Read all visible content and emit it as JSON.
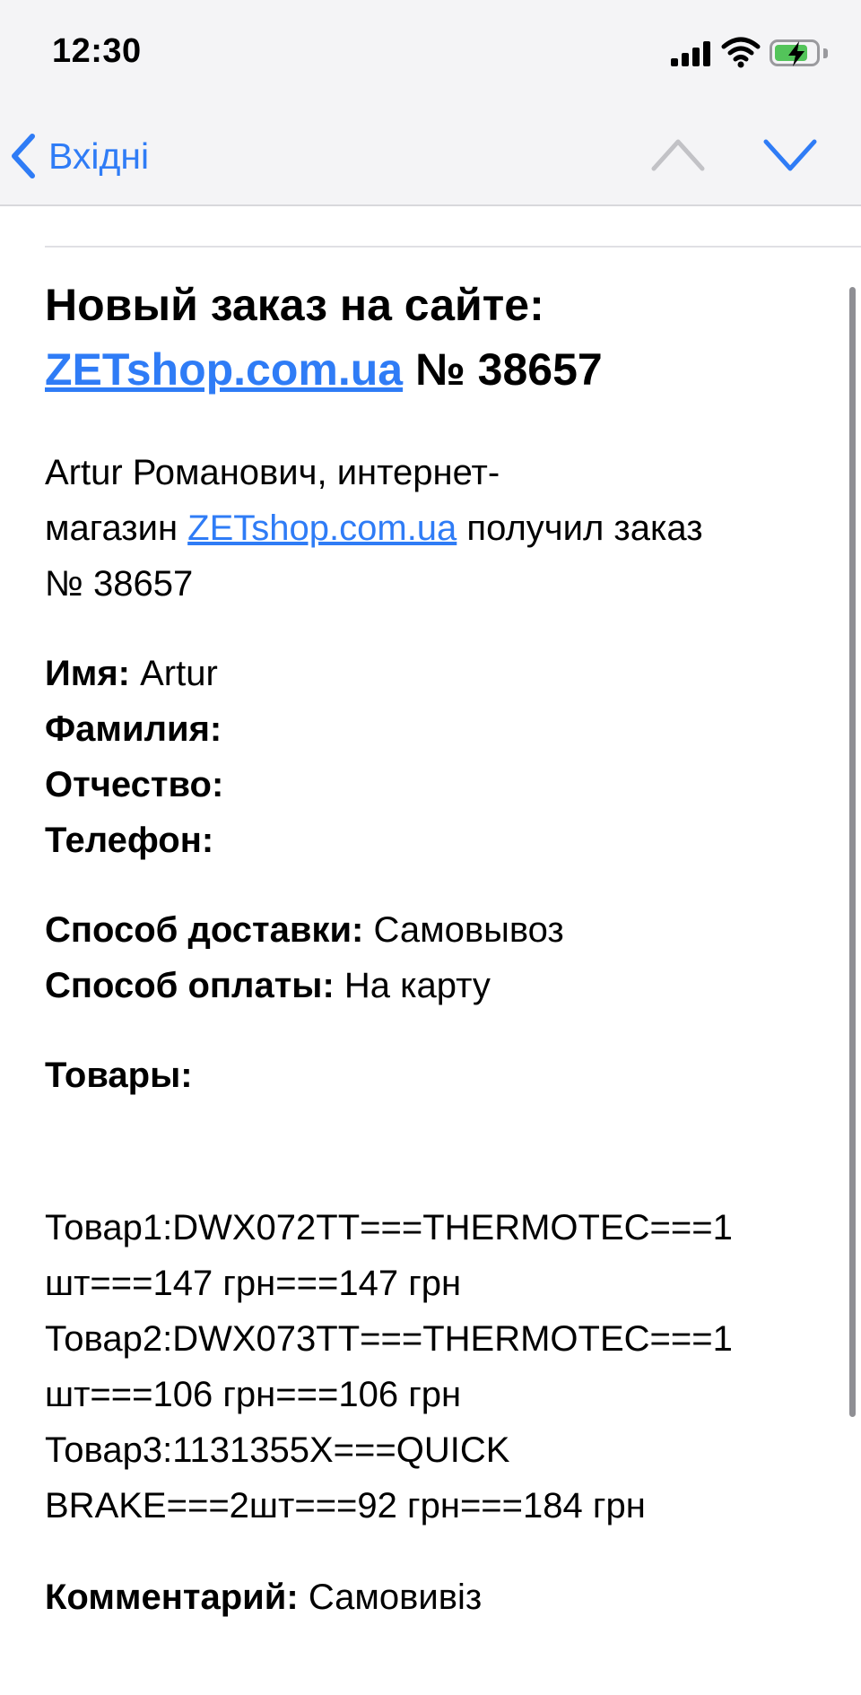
{
  "status_bar": {
    "time": "12:30",
    "icons": [
      "cellular-signal-icon",
      "wifi-icon",
      "battery-charging-icon"
    ],
    "battery_color": "#53c45a"
  },
  "nav": {
    "back_label": "Вхідні",
    "accent": "#2f7cf6",
    "prev_icon": "chevron-up-icon",
    "next_icon": "chevron-down-icon"
  },
  "email": {
    "heading_line1": "Новый заказ на сайте:",
    "heading_link": "ZETshop.com.ua",
    "heading_number": "№ 38657",
    "intro_line1": "Artur Романович, интернет-",
    "intro_prefix": "магазин",
    "intro_link": "ZETshop.com.ua",
    "intro_suffix": "получил заказ",
    "intro_number": "№ 38657",
    "fields": [
      {
        "label": "Имя:",
        "value": "Artur"
      },
      {
        "label": "Фамилия:",
        "value": ""
      },
      {
        "label": "Отчество:",
        "value": ""
      },
      {
        "label": "Телефон:",
        "value": ""
      }
    ],
    "delivery_label": "Способ доставки:",
    "delivery_value": "Самовывоз",
    "payment_label": "Способ оплаты:",
    "payment_value": "На карту",
    "goods_label": "Товары:",
    "goods_lines": [
      "Товар1:DWX072TT===THERMOTEC===1",
      "шт===147 грн===147 грн",
      "Товар2:DWX073TT===THERMOTEC===1",
      "шт===106 грн===106 грн",
      "Товар3:1131355X===QUICK",
      "BRAKE===2шт===92 грн===184 грн"
    ],
    "comment_label": "Комментарий:",
    "comment_value": "Самовивіз"
  }
}
